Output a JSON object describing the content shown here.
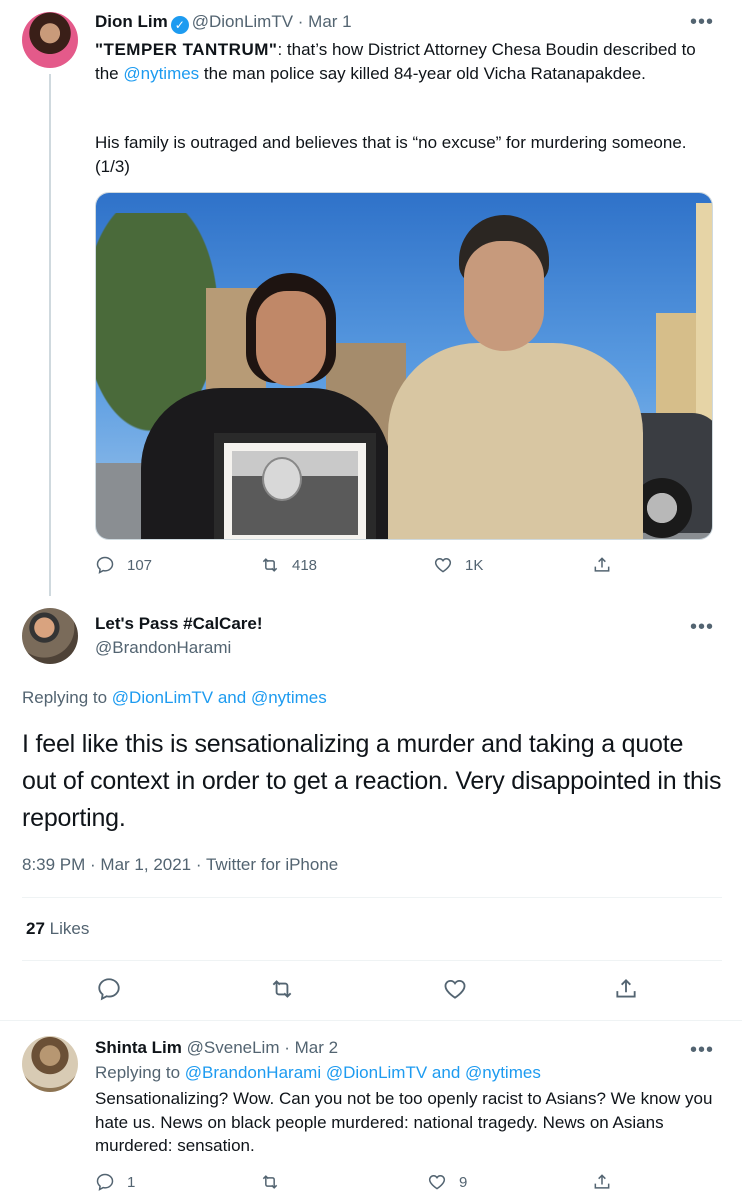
{
  "tweet1": {
    "name": "Dion Lim",
    "handle": "@DionLimTV",
    "date": "Mar 1",
    "text_bold": "\"TEMPER TANTRUM\"",
    "text_1": ": that’s how District Attorney Chesa Boudin described to the ",
    "mention": "@nytimes",
    "text_2": " the man police say killed 84-year old Vicha Ratanapakdee.",
    "text_3": "His family is outraged and believes that is “no excuse” for murdering someone. (1/3)",
    "replies": "107",
    "retweets": "418",
    "likes": "1K",
    "icons": [
      "reply-icon",
      "retweet-icon",
      "like-icon",
      "share-icon",
      "verified-icon",
      "more-icon"
    ]
  },
  "tweet2": {
    "name": "Let's Pass #CalCare!",
    "handle": "@BrandonHarami",
    "replying_prefix": "Replying to ",
    "replying_a": "@DionLimTV",
    "replying_and": " and ",
    "replying_b": "@nytimes",
    "text": "I feel like this is sensationalizing a murder and taking a quote out of context in order to get a reaction. Very disappointed in this reporting.",
    "time": "8:39 PM",
    "date": "Mar 1, 2021",
    "source": "Twitter for iPhone",
    "likes_count": "27",
    "likes_label": " Likes"
  },
  "tweet3": {
    "name": "Shinta Lim",
    "handle": "@SveneLim",
    "date": "Mar 2",
    "replying_prefix": "Replying to ",
    "replying_a": "@BrandonHarami",
    "replying_b": "@DionLimTV",
    "replying_and": " and ",
    "replying_c": "@nytimes",
    "text": "Sensationalizing? Wow. Can you not be too openly racist to Asians? We know you hate us. News on black people murdered: national tragedy. News on Asians murdered: sensation.",
    "replies": "1",
    "likes": "9"
  },
  "colors": {
    "accent": "#1d9bf0",
    "text": "#0f1419",
    "muted": "#536471",
    "border": "#eff3f4"
  }
}
